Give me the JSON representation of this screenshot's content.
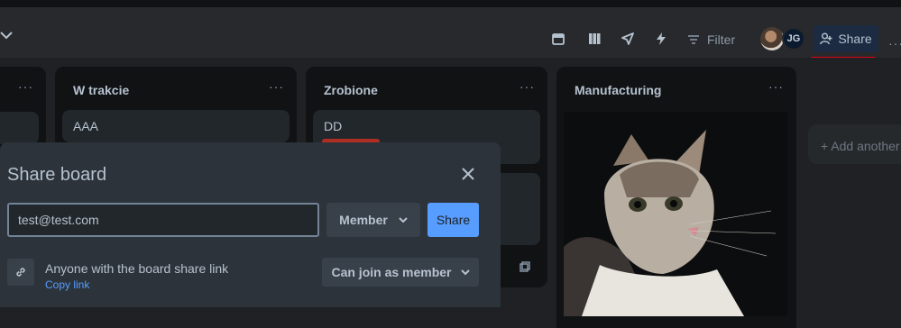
{
  "header": {
    "filter_label": "Filter",
    "avatar_initials": "JG",
    "share_label": "Share",
    "more_label": "···"
  },
  "lists": [
    {
      "title": "",
      "more": "···"
    },
    {
      "title": "W trakcie",
      "more": "···",
      "cards": [
        "AAA"
      ]
    },
    {
      "title": "Zrobione",
      "more": "···",
      "cards": [
        "DD"
      ]
    },
    {
      "title": "Manufacturing",
      "more": "···"
    }
  ],
  "add_list_label": "+ Add another list",
  "dialog": {
    "title": "Share board",
    "email_value": "test@test.com",
    "role_label": "Member",
    "share_button": "Share",
    "link_text": "Anyone with the board share link",
    "copy_link": "Copy link",
    "join_label": "Can join as member"
  },
  "colors": {
    "accent": "#579dff",
    "label_red": "#ae2e24",
    "underline_red": "#e2000f"
  },
  "icons": [
    "chevron-down-icon",
    "calendar-icon",
    "table-icon",
    "rocket-icon",
    "lightning-icon",
    "filter-icon",
    "add-person-icon",
    "close-icon",
    "link-icon",
    "copy-icon"
  ]
}
